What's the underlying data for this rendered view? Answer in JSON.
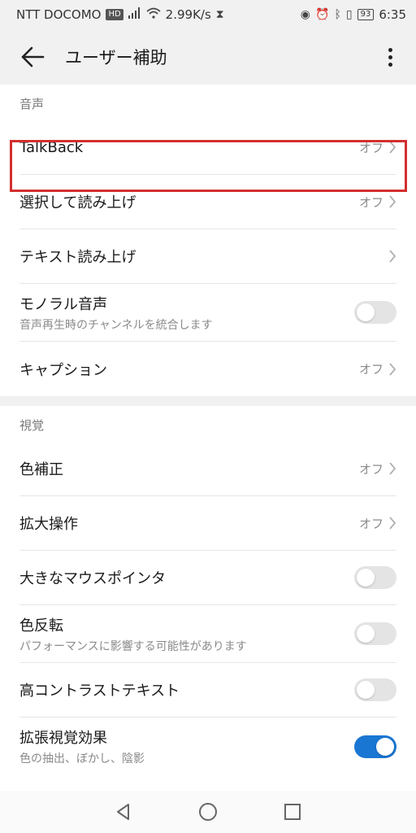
{
  "status_bar": {
    "carrier": "NTT DOCOMO",
    "hd_badge": "HD",
    "signal": "signal-icon",
    "speed": "2.99K/s",
    "battery": "93",
    "time": "6:35"
  },
  "app_bar": {
    "title": "ユーザー補助"
  },
  "sections": {
    "audio": {
      "header": "音声",
      "talkback": {
        "label": "TalkBack",
        "value": "オフ"
      },
      "select_to_speak": {
        "label": "選択して読み上げ",
        "value": "オフ"
      },
      "text_to_speech": {
        "label": "テキスト読み上げ"
      },
      "mono_audio": {
        "label": "モノラル音声",
        "sub": "音声再生時のチャンネルを統合します",
        "enabled": false
      },
      "captions": {
        "label": "キャプション",
        "value": "オフ"
      }
    },
    "vision": {
      "header": "視覚",
      "color_correction": {
        "label": "色補正",
        "value": "オフ"
      },
      "magnification": {
        "label": "拡大操作",
        "value": "オフ"
      },
      "large_pointer": {
        "label": "大きなマウスポインタ",
        "enabled": false
      },
      "color_inversion": {
        "label": "色反転",
        "sub": "パフォーマンスに影響する可能性があります",
        "enabled": false
      },
      "high_contrast": {
        "label": "高コントラストテキスト",
        "enabled": false
      },
      "extended_visual": {
        "label": "拡張視覚効果",
        "sub": "色の抽出、ぼかし、陰影",
        "enabled": true
      }
    }
  },
  "colors": {
    "accent": "#1976d2",
    "highlight": "#d32f2f"
  }
}
